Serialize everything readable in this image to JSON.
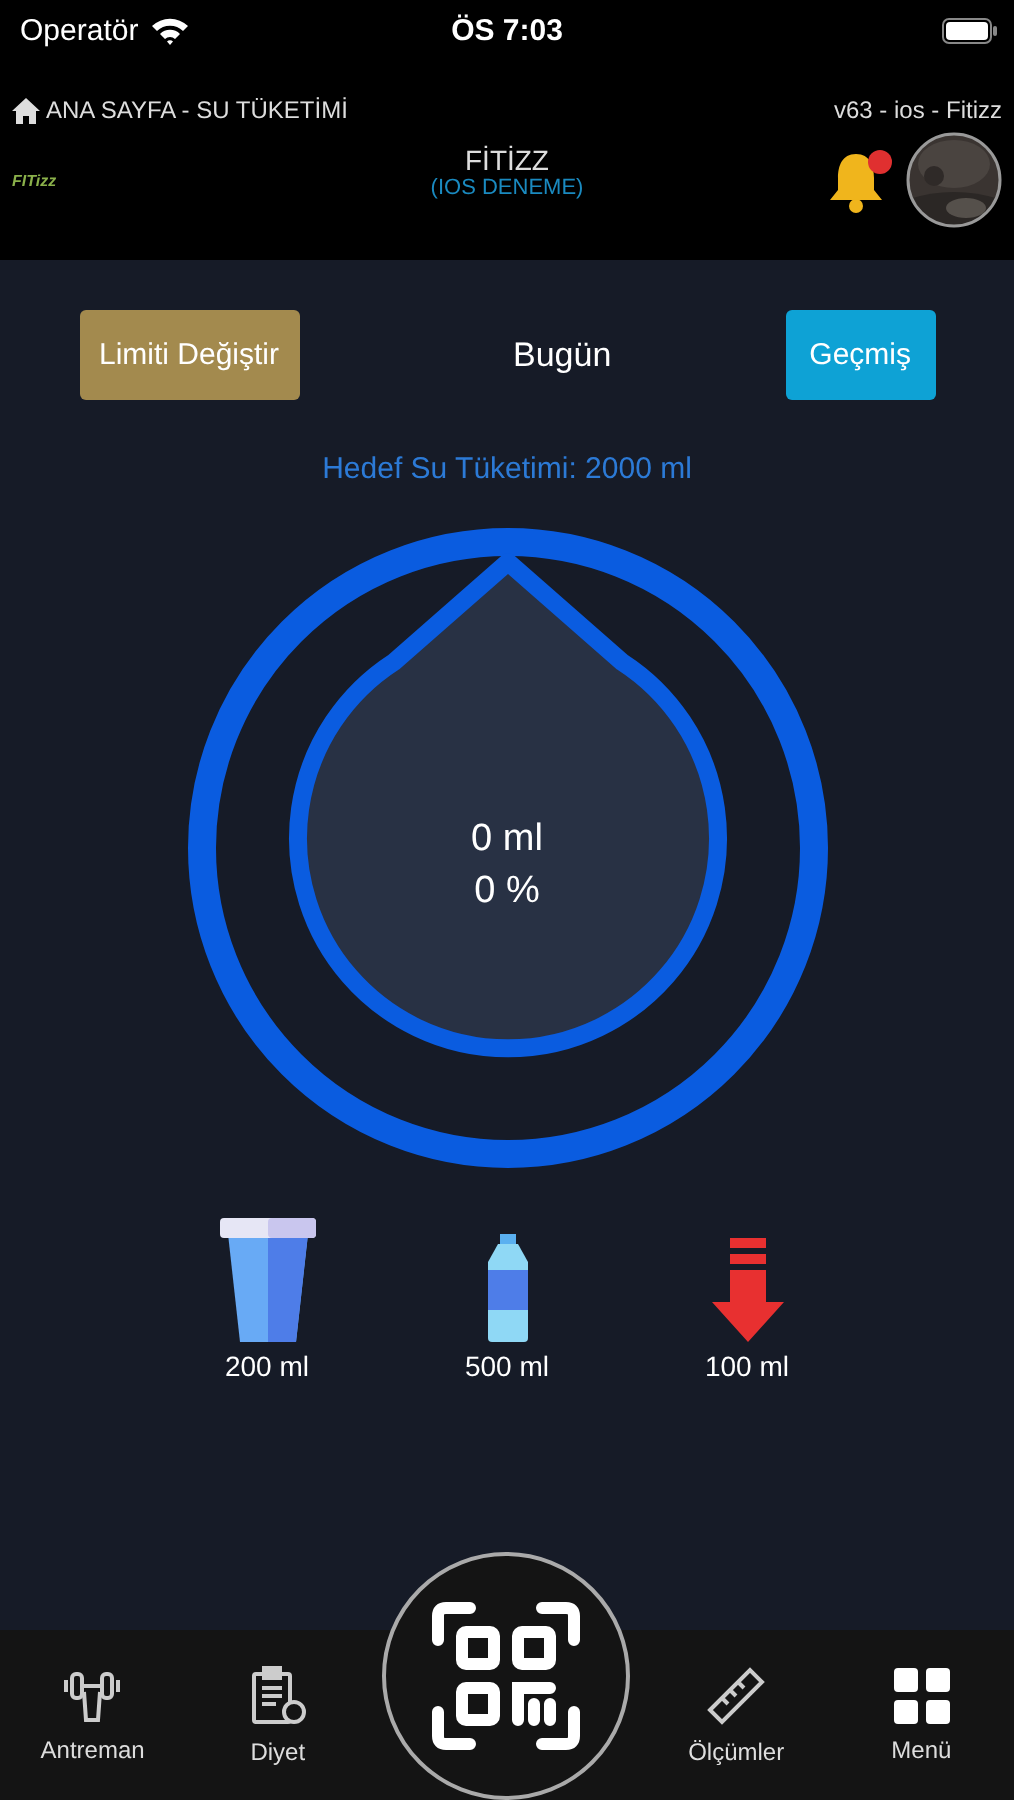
{
  "status_bar": {
    "carrier": "Operatör",
    "time": "ÖS 7:03"
  },
  "header": {
    "breadcrumb": "ANA SAYFA - SU TÜKETİMİ",
    "version": "v63 - ios -  Fitizz",
    "logo_text": "FITizz",
    "title": "FİTİZZ",
    "subtitle": "(IOS DENEME)",
    "notification": true
  },
  "controls": {
    "limit_button": "Limiti Değiştir",
    "day": "Bugün",
    "history_button": "Geçmiş"
  },
  "goal": "Hedef Su Tüketimi: 2000 ml",
  "gauge": {
    "amount": "0 ml",
    "percent": "0 %"
  },
  "drinks": [
    {
      "kind": "cup",
      "label": "200 ml"
    },
    {
      "kind": "bottle",
      "label": "500 ml"
    },
    {
      "kind": "remove",
      "label": "100 ml"
    }
  ],
  "tab_bar": [
    {
      "kind": "dumbbell",
      "label": "Antreman"
    },
    {
      "kind": "diet",
      "label": "Diyet"
    },
    {
      "kind": "scan"
    },
    {
      "kind": "ruler",
      "label": "Ölçümler"
    },
    {
      "kind": "grid",
      "label": "Menü"
    }
  ]
}
